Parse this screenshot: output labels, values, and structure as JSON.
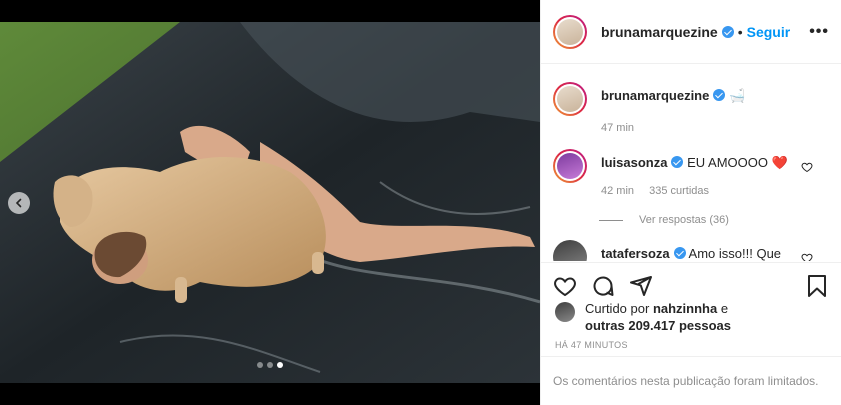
{
  "post": {
    "author": "bruna marquezine",
    "author_handle": "brunamarquezine",
    "follow_label": "Seguir",
    "separator": "•",
    "more_label": "•••"
  },
  "caption": {
    "user": "brunamarquezine",
    "text": "🛁",
    "time": "47 min"
  },
  "comments": [
    {
      "user": "luisasonza",
      "text": "EU AMOOOO ❤️",
      "time": "42 min",
      "likes": "335 curtidas",
      "replies": "Ver respostas (36)"
    },
    {
      "user": "tatafersoza",
      "text": "Amo isso!!! Que"
    }
  ],
  "likes": {
    "prefix": "Curtido por",
    "user": "nahzinnha",
    "conj": "e",
    "others": "outras 209.417 pessoas"
  },
  "time_ago": "HÁ 47 MINUTOS",
  "comments_limited": "Os comentários nesta publicação foram limitados.",
  "carousel": {
    "total": 3,
    "active": 3
  },
  "colors": {
    "accent": "#0095f6",
    "verified": "#3897f0",
    "heart": "#ed4956"
  },
  "icons": [
    "chevron-left-icon",
    "verified-icon",
    "heart-icon",
    "comment-icon",
    "share-icon",
    "bookmark-icon"
  ]
}
